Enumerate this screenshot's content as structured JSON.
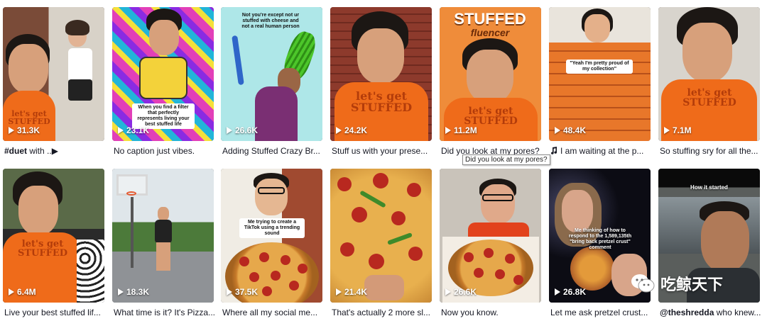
{
  "videos": [
    {
      "views": "31.3K",
      "caption_bold": "#duet",
      "caption": " with ..▶"
    },
    {
      "views": "23.1K",
      "caption_bold": "",
      "caption": "No caption just vibes.",
      "overlay": "When you find a filter that perfectly represents living your best stuffed life"
    },
    {
      "views": "26.6K",
      "caption_bold": "",
      "caption": "Adding Stuffed Crazy Br...",
      "overlay": "Not you're except not ur stuffed with cheese and not a real human person"
    },
    {
      "views": "24.2K",
      "caption_bold": "",
      "caption": "Stuff us with your prese...",
      "shirt": "let's get STUFFED"
    },
    {
      "views": "11.2M",
      "caption_bold": "",
      "caption": "Did you look at my pores?",
      "banner": "STUFFED",
      "banner_sub": "fluencer",
      "shirt": "let's get STUFFED"
    },
    {
      "views": "48.4K",
      "caption_bold": "",
      "caption": "I am waiting at the p...",
      "overlay": "\"Yeah I'm pretty proud of my collection\""
    },
    {
      "views": "7.1M",
      "caption_bold": "",
      "caption": "So stuffing sry for all the...",
      "shirt": "let's get STUFFED"
    },
    {
      "views": "6.4M",
      "caption_bold": "",
      "caption": "Live your best stuffed lif...",
      "shirt": "let's get STUFFED"
    },
    {
      "views": "18.3K",
      "caption_bold": "",
      "caption": "What time is it? It's Pizza..."
    },
    {
      "views": "37.5K",
      "caption_bold": "",
      "caption": "Where all my social me...",
      "overlay": "Me trying to create a TikTok using a trending sound"
    },
    {
      "views": "21.4K",
      "caption_bold": "",
      "caption": "That's actually 2 more sl..."
    },
    {
      "views": "26.6K",
      "caption_bold": "",
      "caption": "Now you know."
    },
    {
      "views": "26.8K",
      "caption_bold": "",
      "caption": "Let me ask pretzel crust...",
      "overlay": "Me thinking of how to respond to the 1,589,135th \"bring back pretzel crust\" comment"
    },
    {
      "views": "",
      "caption_bold": "@theshredda",
      "caption": " who knew...",
      "overlay": "How it started"
    }
  ],
  "tooltip": "Did you look at my pores?",
  "watermark": "吃鲸天下",
  "colors": {
    "accent": "#ef6b1a",
    "text": "#161823"
  },
  "icons": {
    "play": "play-icon",
    "music": "music-note-icon",
    "wechat": "wechat-icon"
  }
}
